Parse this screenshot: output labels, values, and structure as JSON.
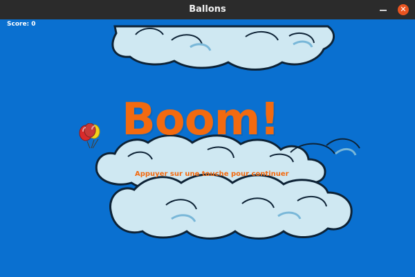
{
  "window": {
    "title": "Ballons",
    "close_icon": "close-icon",
    "minimize_icon": "minimize-icon"
  },
  "hud": {
    "score_text": "Score: 0"
  },
  "message": {
    "title": "Boom!",
    "subtitle": "Appuyer sur une touche pour continuer"
  },
  "icons": {
    "balloons": "balloons-icon"
  },
  "colors": {
    "sky": "#0a70d0",
    "cloud_fill": "#cfe8f2",
    "cloud_outline": "#0d2235",
    "accent_orange": "#f26a10",
    "close_button": "#e95420",
    "titlebar": "#2b2b2b"
  }
}
